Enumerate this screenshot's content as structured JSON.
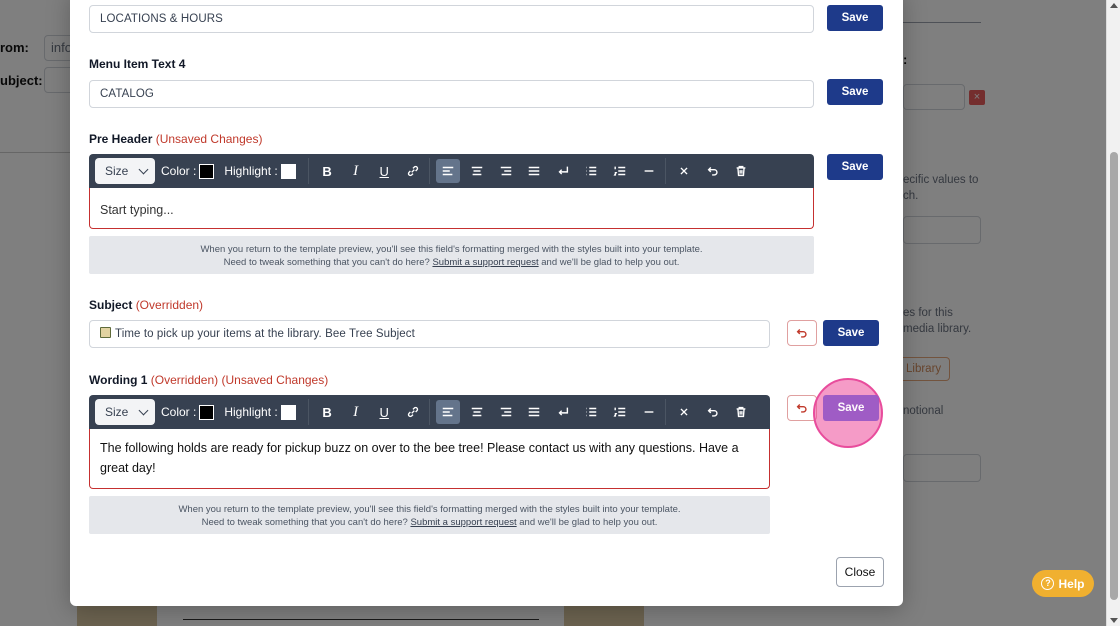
{
  "background": {
    "from_label": "rom:",
    "from_value": "info",
    "subject_label": "ubject:",
    "right_help_1": "ecific values to",
    "right_help_2": "ch.",
    "right_help_3": "es for this",
    "right_help_4": "media library.",
    "library_button": "Library",
    "promotional_text": "notional"
  },
  "modal": {
    "fields": [
      {
        "value": "LOCATIONS & HOURS",
        "save_label": "Save"
      },
      {
        "label": "Menu Item Text 4",
        "value": "CATALOG",
        "save_label": "Save"
      }
    ],
    "pre_header": {
      "label": "Pre Header",
      "status": "(Unsaved Changes)",
      "placeholder": "Start typing...",
      "save_label": "Save"
    },
    "subject": {
      "label": "Subject",
      "status": "(Overridden)",
      "value": "Time to pick up your items at the library. Bee Tree Subject",
      "save_label": "Save"
    },
    "wording1": {
      "label": "Wording 1",
      "status": "(Overridden) (Unsaved Changes)",
      "body": "The following holds are ready for pickup buzz on over to the bee tree! Please contact us with any questions. Have a great day!",
      "save_label": "Save"
    },
    "toolbar": {
      "size_label": "Size",
      "color_label": "Color :",
      "highlight_label": "Highlight :"
    },
    "notice": {
      "line1": "When you return to the template preview, you'll see this field's formatting merged with the styles built into your template.",
      "line2_pre": "Need to tweak something that you can't do here?",
      "link": "Submit a support request",
      "line2_post": "and we'll be glad to help you out."
    },
    "close_label": "Close"
  },
  "help_label": "Help",
  "colors": {
    "save_button": "#1e3a8a",
    "warning_text": "#c0392b",
    "toolbar_bg": "#374151",
    "help_button": "#f0b030",
    "click_highlight": "#e84c9c"
  }
}
